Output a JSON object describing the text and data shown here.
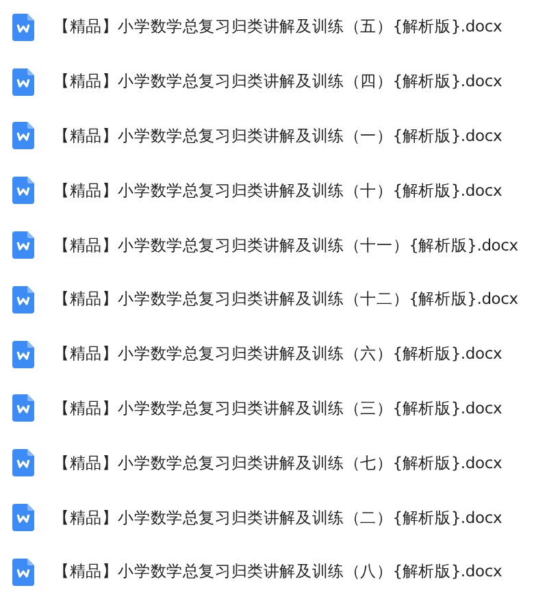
{
  "files": [
    {
      "name": "【精品】小学数学总复习归类讲解及训练（五）{解析版}.docx"
    },
    {
      "name": "【精品】小学数学总复习归类讲解及训练（四）{解析版}.docx"
    },
    {
      "name": "【精品】小学数学总复习归类讲解及训练（一）{解析版}.docx"
    },
    {
      "name": "【精品】小学数学总复习归类讲解及训练（十）{解析版}.docx"
    },
    {
      "name": "【精品】小学数学总复习归类讲解及训练（十一）{解析版}.docx"
    },
    {
      "name": "【精品】小学数学总复习归类讲解及训练（十二）{解析版}.docx"
    },
    {
      "name": "【精品】小学数学总复习归类讲解及训练（六）{解析版}.docx"
    },
    {
      "name": "【精品】小学数学总复习归类讲解及训练（三）{解析版}.docx"
    },
    {
      "name": "【精品】小学数学总复习归类讲解及训练（七）{解析版}.docx"
    },
    {
      "name": "【精品】小学数学总复习归类讲解及训练（二）{解析版}.docx"
    },
    {
      "name": "【精品】小学数学总复习归类讲解及训练（八）{解析版}.docx"
    }
  ]
}
